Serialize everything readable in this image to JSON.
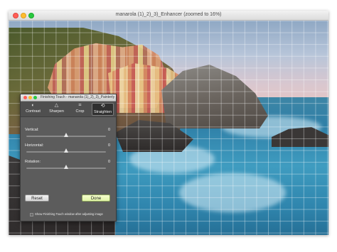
{
  "window": {
    "title": "manarola (1)_2)_3)_Enhancer (zoomed to 16%)"
  },
  "panel": {
    "title": "Finishing Touch - manarola (1)_2)_3)_Painterly",
    "tools": [
      {
        "label": "Contrast",
        "icon": "◐"
      },
      {
        "label": "Sharpen",
        "icon": "△"
      },
      {
        "label": "Crop",
        "icon": "⌗"
      },
      {
        "label": "Straighten",
        "icon": "⟲"
      }
    ],
    "active_tool": "Straighten",
    "sliders": [
      {
        "label": "Vertical:",
        "value": "0",
        "level": 0.5
      },
      {
        "label": "Horizontal:",
        "value": "0",
        "level": 0.5
      },
      {
        "label": "Rotation:",
        "value": "0",
        "level": 0.5
      }
    ],
    "reset_label": "Reset",
    "done_label": "Done",
    "checkbox_label": "Show Finishing Touch window after adjusting image",
    "checkbox_checked": false
  },
  "colors": {
    "panel_bg": "#5c5c5c",
    "done_accent": "#e0f5a6"
  }
}
